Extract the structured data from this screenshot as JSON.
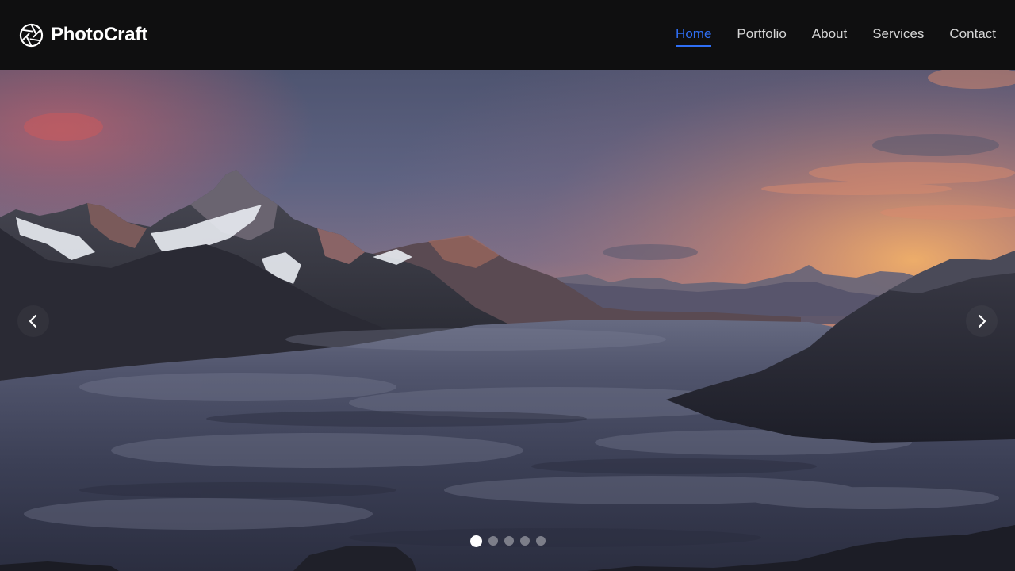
{
  "brand": {
    "name": "PhotoCraft",
    "icon": "aperture-icon"
  },
  "nav": {
    "items": [
      {
        "label": "Home",
        "active": true
      },
      {
        "label": "Portfolio",
        "active": false
      },
      {
        "label": "About",
        "active": false
      },
      {
        "label": "Services",
        "active": false
      },
      {
        "label": "Contact",
        "active": false
      }
    ]
  },
  "hero": {
    "image": "mountain-sunset-above-clouds",
    "prev_icon": "chevron-left-icon",
    "next_icon": "chevron-right-icon",
    "slide_count": 5,
    "active_slide": 1
  },
  "colors": {
    "background": "#0f0f10",
    "accent": "#2f6ff5",
    "nav_text": "#d6d6d6",
    "brand_text": "#ffffff"
  }
}
